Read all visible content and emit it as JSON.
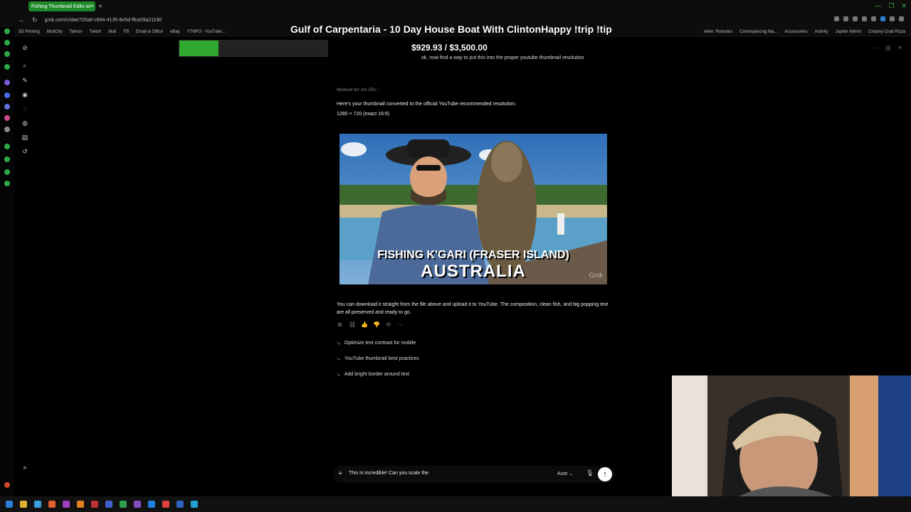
{
  "browser": {
    "tab_title": "Fishing Thumbnail Edits w/",
    "tab_close": "×",
    "new_tab": "+",
    "url": "grok.com/c/dae705a8-c894-4135-8e5d-ffca09a21190",
    "nav": {
      "back": "←",
      "reload": "↻"
    },
    "window_controls": [
      "—",
      "❐",
      "✕"
    ],
    "bookmarks": [
      "3D Printing",
      "ModCity",
      "Tarkov",
      "Twitch",
      "Mail",
      "FB",
      "Email & Office",
      "eBay",
      "YTMP3 - YouTube..."
    ],
    "bookmarks_right": [
      "Alien: Romulus",
      "Conveyancing Ma...",
      "Accessories",
      "Activity",
      "Jupiter Admin",
      "Creamy Crab Pizza"
    ]
  },
  "stream": {
    "title": "Gulf of Carpentaria - 10 Day House Boat With ClintonHappy !trip !tip",
    "donation_text": "$929.93 / $3,500.00",
    "donation_progress": 0.266
  },
  "chat": {
    "user_message": "ok, now find a way to put this into the proper youtube thumbnail resolution",
    "worked_label": "Worked for 1m 25s ›",
    "response_intro": "Here's your thumbnail converted to the official YouTube recommended resolution:",
    "response_res": "1280 × 720 (exact 16:9)",
    "thumbnail": {
      "line1": "FISHING K'GARI (FRASER ISLAND)",
      "line2": "AUSTRALIA",
      "watermark": "Grok"
    },
    "response_followup": "You can download it straight from the file above and upload it to YouTube. The composition, clean fish, and big popping text are all preserved and ready to go.",
    "actions": [
      "⧉",
      "⛓",
      "👍",
      "👎",
      "⟲",
      "⋯"
    ],
    "suggestions": [
      "Optimize text contrast for mobile",
      "YouTube thumbnail best practices",
      "Add bright border around text"
    ],
    "suggestion_arrow": "↳"
  },
  "composer": {
    "plus": "+",
    "text": "This is incredible! Can you scale the",
    "mode": "Auto ⌄",
    "mic": "🎙",
    "send": "↑"
  },
  "colors": {
    "accent_green": "#2ea82e",
    "background": "#000000"
  }
}
